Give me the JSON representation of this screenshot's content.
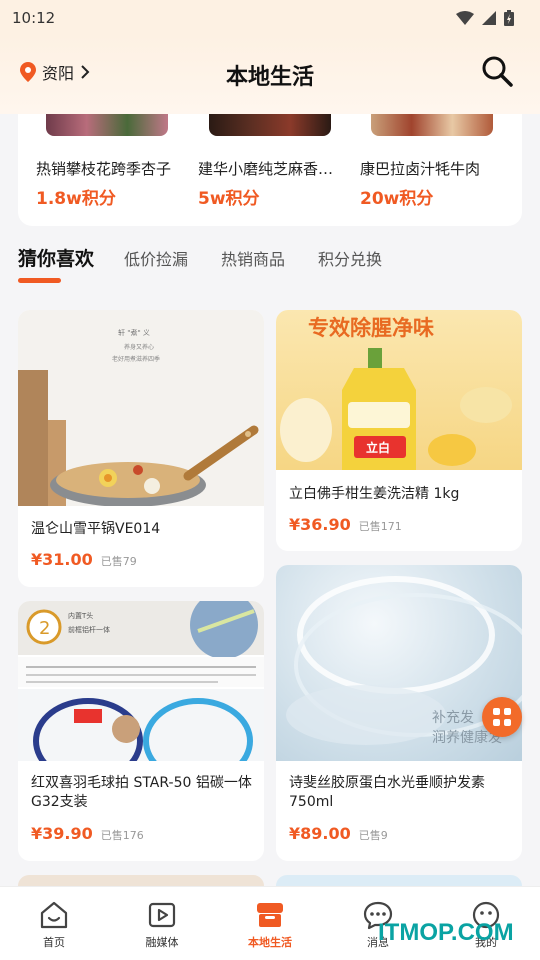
{
  "status_bar": {
    "time": "10:12"
  },
  "header": {
    "location": "资阳",
    "title": "本地生活"
  },
  "featured": [
    {
      "name": "热销攀枝花跨季杏子",
      "points": "1.8w积分"
    },
    {
      "name": "建华小磨纯芝麻香…",
      "points": "5w积分"
    },
    {
      "name": "康巴拉卤汁牦牛肉",
      "points": "20w积分"
    }
  ],
  "tabs": [
    {
      "label": "猜你喜欢"
    },
    {
      "label": "低价捡漏"
    },
    {
      "label": "热销商品"
    },
    {
      "label": "积分兑换"
    }
  ],
  "products": [
    {
      "name": "温仑山雪平锅VE014",
      "price": "¥31.00",
      "sold": "已售79",
      "image_text": [
        "轩 \"煮\" 义",
        "养身又养心",
        "老好用煮滋养四季"
      ]
    },
    {
      "name": "立白佛手柑生姜洗洁精 1kg",
      "price": "¥36.90",
      "sold": "已售171",
      "image_text": [
        "专效除腥净味",
        "立白"
      ]
    },
    {
      "name": "红双喜羽毛球拍 STAR-50 铝碳一体 G32支装",
      "price": "¥39.90",
      "sold": "已售176",
      "image_text": [
        "内置T头",
        "前框铝杆一体"
      ]
    },
    {
      "name": "诗斐丝胶原蛋白水光垂顺护发素 750ml",
      "price": "¥89.00",
      "sold": "已售9",
      "image_text": [
        "补充发",
        "润养健康发"
      ]
    }
  ],
  "bottom_nav": [
    {
      "label": "首页",
      "icon": "home-face-icon"
    },
    {
      "label": "融媒体",
      "icon": "media-play-icon"
    },
    {
      "label": "本地生活",
      "icon": "shop-box-icon"
    },
    {
      "label": "消息",
      "icon": "chat-bubble-icon"
    },
    {
      "label": "我的",
      "icon": "profile-face-icon"
    }
  ],
  "watermark": "ITMOP.COM",
  "colors": {
    "accent": "#f05a23",
    "header_bg": "#fdf1e3",
    "watermark": "#0aa3a3"
  }
}
